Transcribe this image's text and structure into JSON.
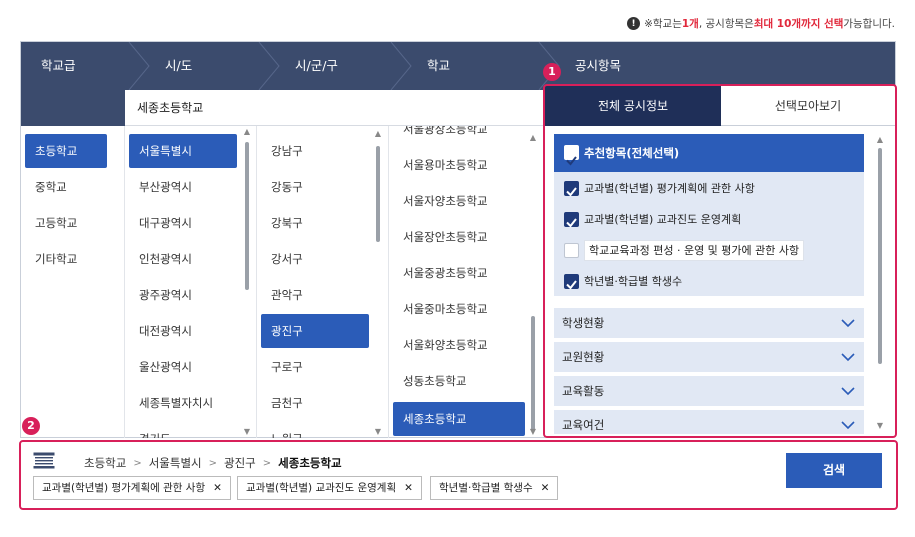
{
  "notice": {
    "prefix": "※학교는 ",
    "school_limit": "1개",
    "middle": ", 공시항목은 ",
    "item_limit": "최대 10개까지 선택",
    "suffix": " 가능합니다."
  },
  "header": {
    "level": "학교급",
    "sido": "시/도",
    "sigungu": "시/군/구",
    "school": "학교",
    "items": "공시항목"
  },
  "selected_school_field": "세종초등학교",
  "school_levels": [
    "초등학교",
    "중학교",
    "고등학교",
    "기타학교"
  ],
  "sido_list": [
    "서울특별시",
    "부산광역시",
    "대구광역시",
    "인천광역시",
    "광주광역시",
    "대전광역시",
    "울산광역시",
    "세종특별자치시",
    "경기도"
  ],
  "sigungu_list": [
    "강남구",
    "강동구",
    "강북구",
    "강서구",
    "관악구",
    "광진구",
    "구로구",
    "금천구",
    "노원구"
  ],
  "school_list": [
    "서울광장초등학교",
    "서울용마초등학교",
    "서울자양초등학교",
    "서울장안초등학교",
    "서울중광초등학교",
    "서울중마초등학교",
    "서울화양초등학교",
    "성동초등학교",
    "세종초등학교"
  ],
  "tabs": {
    "all": "전체 공시정보",
    "selected": "선택모아보기"
  },
  "recommended": {
    "title": "추천항목(전체선택)",
    "items": [
      {
        "label": "교과별(학년별) 평가계획에 관한 사항",
        "checked": true
      },
      {
        "label": "교과별(학년별) 교과진도 운영계획",
        "checked": true
      },
      {
        "label": "학교교육과정 편성 · 운영 및 평가에 관한 사항",
        "checked": false
      },
      {
        "label": "학년별·학급별 학생수",
        "checked": true
      }
    ]
  },
  "categories": [
    "학생현황",
    "교원현황",
    "교육활동",
    "교육여건"
  ],
  "markers": {
    "one": "1",
    "two": "2"
  },
  "breadcrumb": {
    "level": "초등학교",
    "sido": "서울특별시",
    "sigungu": "광진구",
    "school": "세종초등학교"
  },
  "chips": [
    {
      "label": "교과별(학년별) 평가계획에 관한 사항"
    },
    {
      "label": "교과별(학년별) 교과진도 운영계획"
    },
    {
      "label": "학년별·학급별 학생수"
    }
  ],
  "chip_remove": "✕",
  "search_button": "검색",
  "colors": {
    "header": "#3b4b6d",
    "accent": "#2b5cb8",
    "highlight": "#d8205a",
    "tab_active": "#1f2f58"
  }
}
